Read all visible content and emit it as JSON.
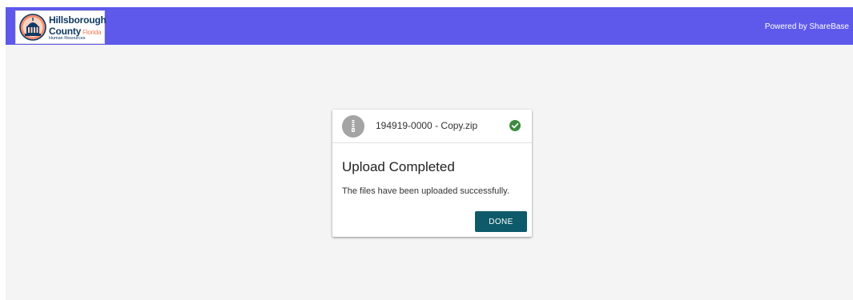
{
  "header": {
    "logo": {
      "line1": "Hillsborough",
      "line2": "County",
      "state": "Florida",
      "line3": "Human Resources"
    },
    "powered_by": "Powered by ShareBase",
    "background_color": "#5e59ea"
  },
  "upload": {
    "file_name": "194919-0000 - Copy.zip",
    "file_icon": "zip-file-icon",
    "status_icon": "check-circle-icon",
    "status_color": "#3d8b40",
    "title": "Upload Completed",
    "message": "The files have been uploaded successfully.",
    "done_label": "DONE",
    "button_color": "#0e5a6a"
  }
}
